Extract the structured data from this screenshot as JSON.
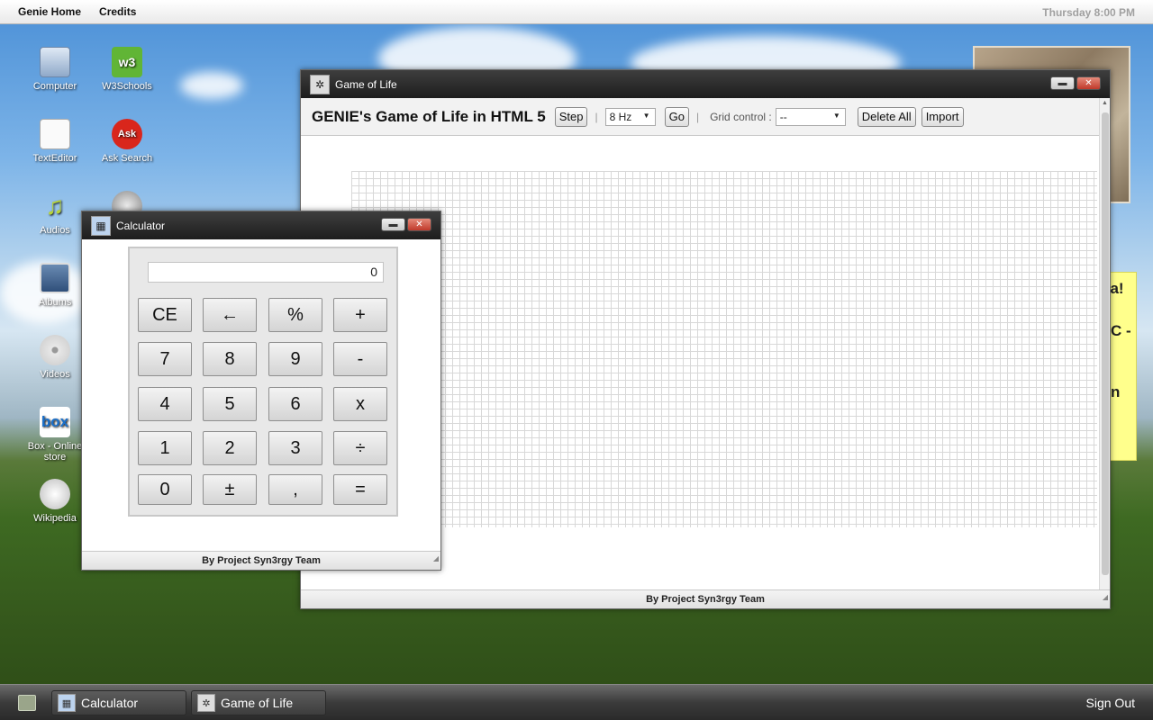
{
  "topbar": {
    "home": "Genie Home",
    "credits": "Credits",
    "clock": "Thursday 8:00 PM"
  },
  "desktop": {
    "icons": [
      {
        "label": "Computer",
        "icon": "computer-icon"
      },
      {
        "label": "W3Schools",
        "icon": "w3schools-icon"
      },
      {
        "label": "TextEditor",
        "icon": "text-editor-icon"
      },
      {
        "label": "Ask Search",
        "icon": "ask-search-icon"
      },
      {
        "label": "Audios",
        "icon": "music-note-icon"
      },
      {
        "label": "Albums",
        "icon": "photo-album-icon"
      },
      {
        "label": "Videos",
        "icon": "disc-icon"
      },
      {
        "label": "Box - Online store",
        "icon": "box-icon"
      },
      {
        "label": "Wikipedia",
        "icon": "wikipedia-icon"
      }
    ],
    "box_badge": "box",
    "w3_badge": "w3",
    "ask_badge": "Ask"
  },
  "sticky": {
    "line1": "ka!",
    "line2": "C -",
    "line3": "n"
  },
  "gol": {
    "title": "Game of Life",
    "heading": "GENIE's Game of Life in HTML 5",
    "step": "Step",
    "speed": "8 Hz",
    "go": "Go",
    "grid_label": "Grid control :",
    "grid_value": "--",
    "delete_all": "Delete All",
    "import": "Import",
    "status": "By Project Syn3rgy Team",
    "sep": "|"
  },
  "calc": {
    "title": "Calculator",
    "display": "0",
    "buttons": [
      "CE",
      "←",
      "%",
      "+",
      "7",
      "8",
      "9",
      "-",
      "4",
      "5",
      "6",
      "x",
      "1",
      "2",
      "3",
      "÷",
      "0",
      "±",
      ",",
      "="
    ],
    "status": "By Project Syn3rgy Team"
  },
  "taskbar": {
    "task1": "Calculator",
    "task2": "Game of Life",
    "signout": "Sign Out"
  },
  "colors": {
    "close": "#c0392b",
    "titlebar": "#2a2a2a",
    "sticky": "#ffff8c"
  }
}
